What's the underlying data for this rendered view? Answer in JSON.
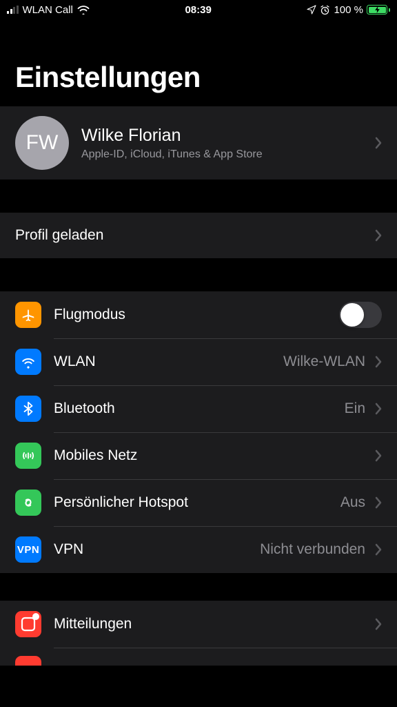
{
  "status": {
    "carrier": "WLAN Call",
    "time": "08:39",
    "battery_text": "100 %"
  },
  "title": "Einstellungen",
  "profile": {
    "initials": "FW",
    "name": "Wilke Florian",
    "subtitle": "Apple-ID, iCloud, iTunes & App Store"
  },
  "profile_loaded": {
    "label": "Profil geladen"
  },
  "network": {
    "airplane": {
      "label": "Flugmodus"
    },
    "wlan": {
      "label": "WLAN",
      "value": "Wilke-WLAN"
    },
    "bluetooth": {
      "label": "Bluetooth",
      "value": "Ein"
    },
    "cellular": {
      "label": "Mobiles Netz"
    },
    "hotspot": {
      "label": "Persönlicher Hotspot",
      "value": "Aus"
    },
    "vpn": {
      "label": "VPN",
      "value": "Nicht verbunden",
      "badge": "VPN"
    }
  },
  "general": {
    "notifications": {
      "label": "Mitteilungen"
    }
  }
}
